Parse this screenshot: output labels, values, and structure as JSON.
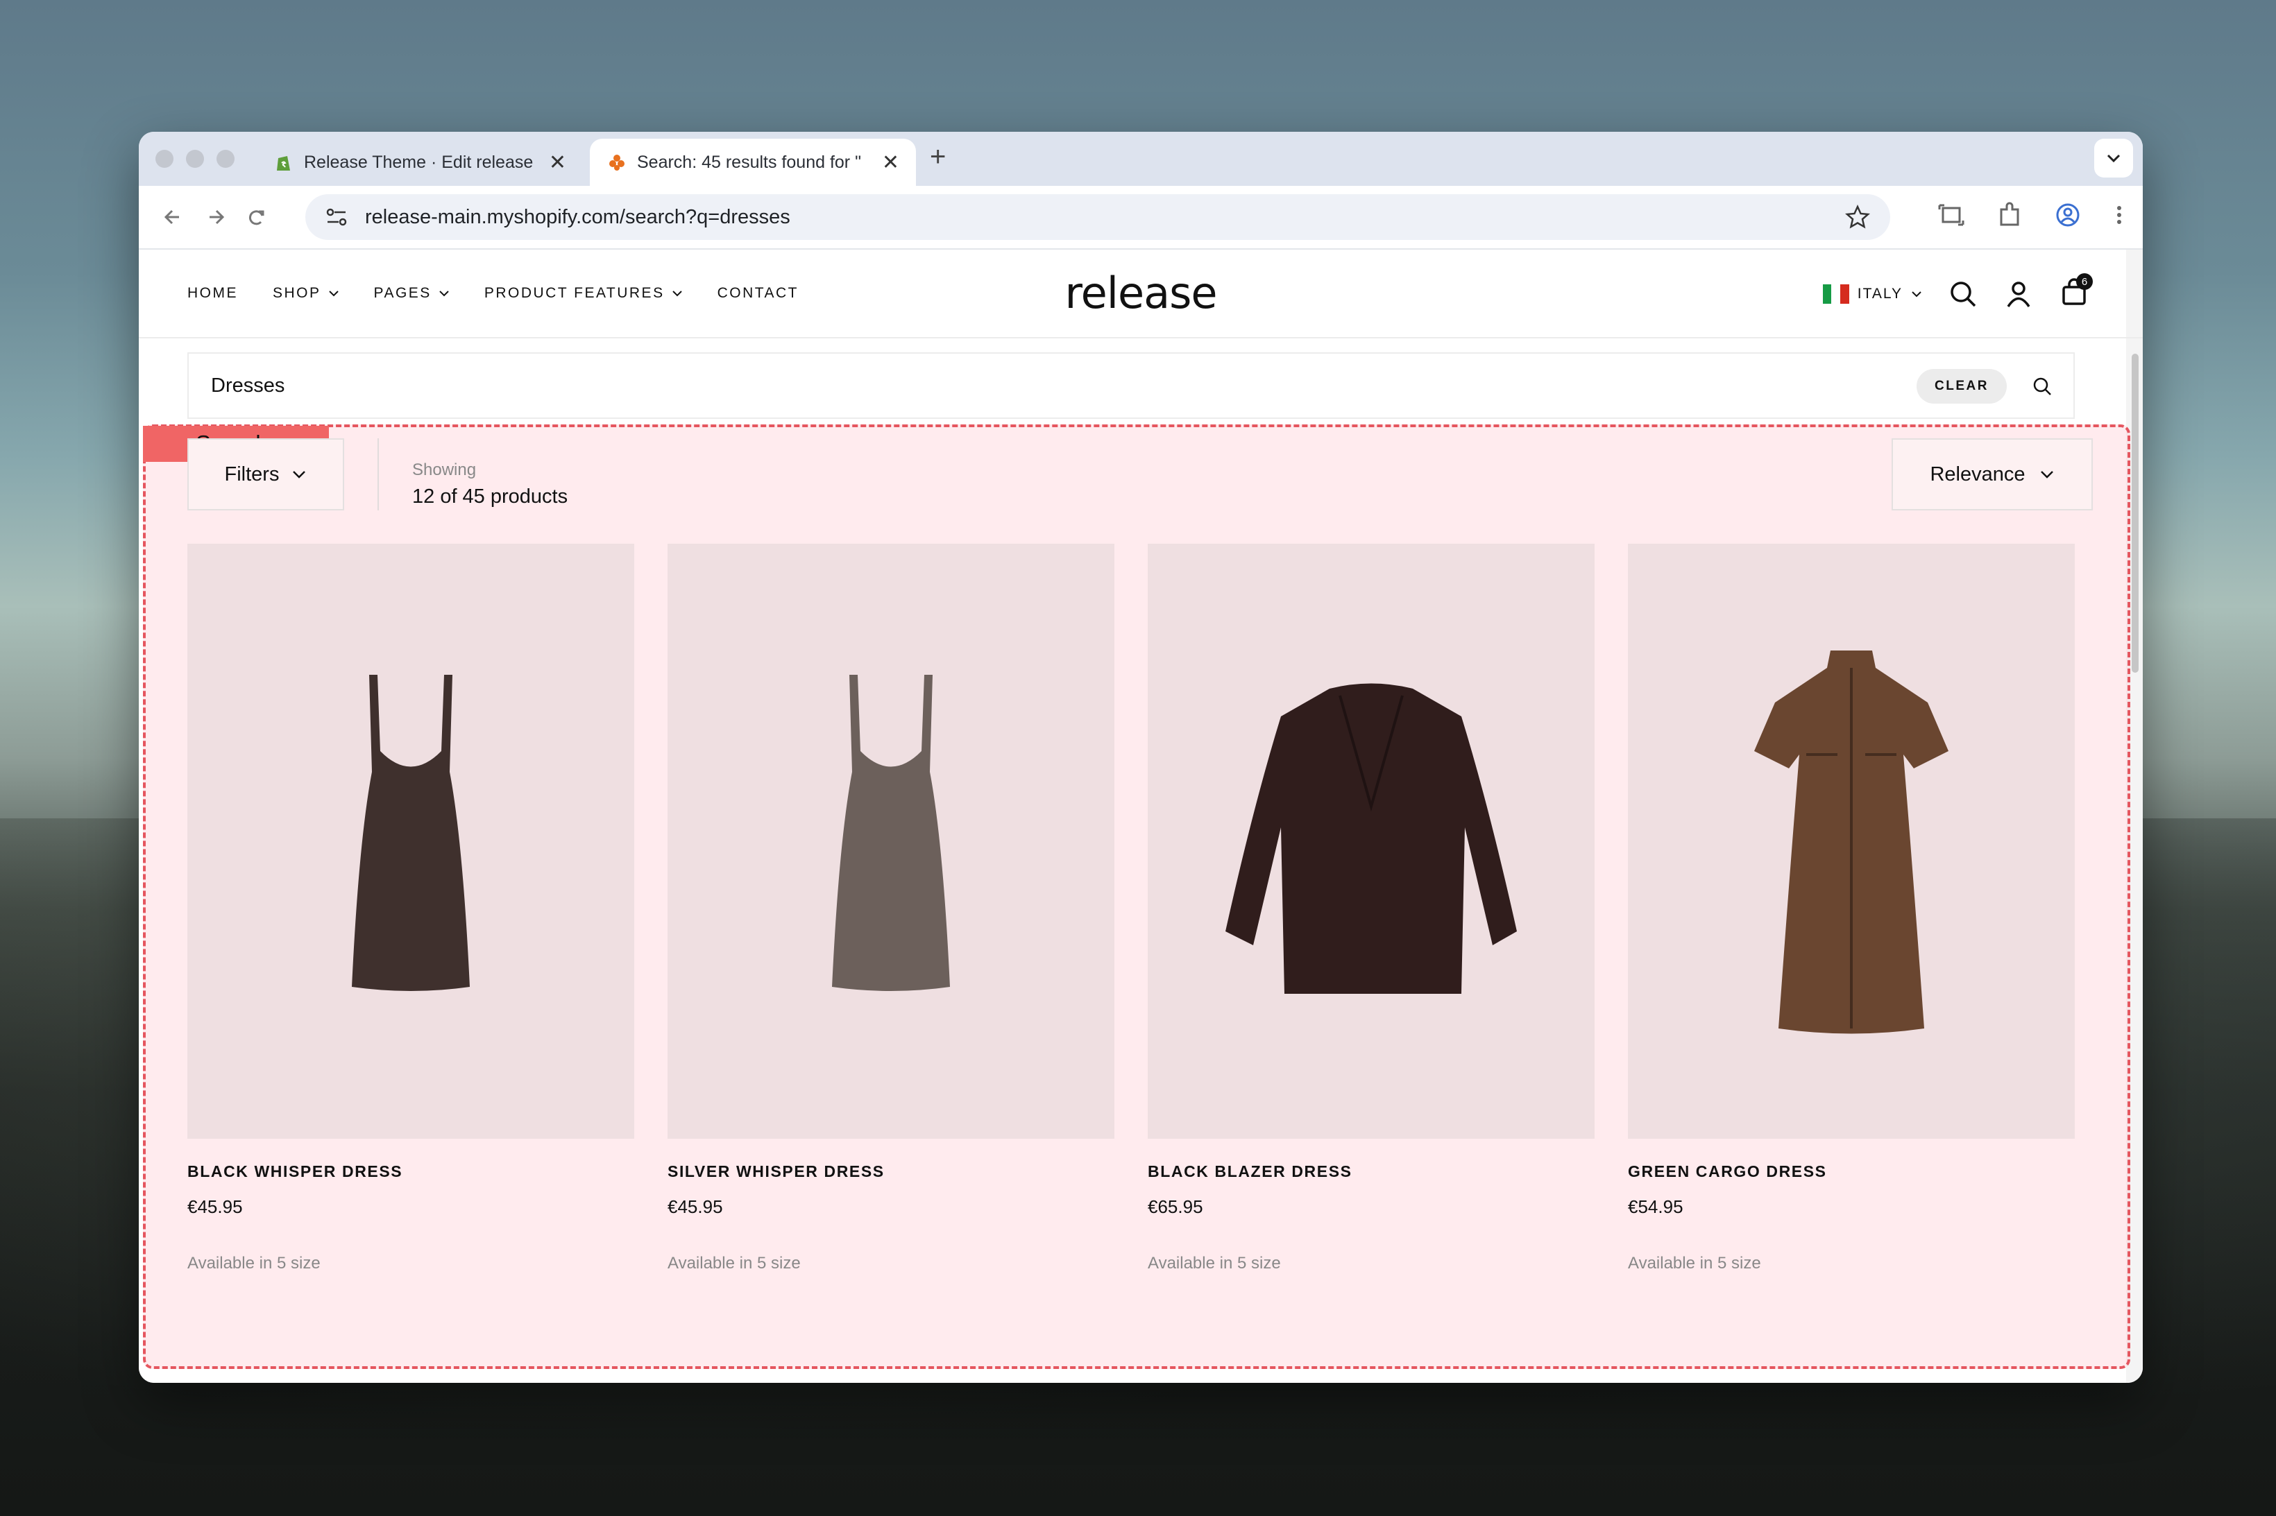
{
  "browser": {
    "tabs": [
      {
        "title": "Release Theme · Edit release",
        "active": false
      },
      {
        "title": "Search: 45 results found for \"",
        "active": true
      }
    ],
    "new_tab": "+",
    "close": "✕",
    "url": "release-main.myshopify.com/search?q=dresses"
  },
  "site": {
    "nav": [
      {
        "label": "HOME",
        "dropdown": false
      },
      {
        "label": "SHOP",
        "dropdown": true
      },
      {
        "label": "PAGES",
        "dropdown": true
      },
      {
        "label": "PRODUCT FEATURES",
        "dropdown": true
      },
      {
        "label": "CONTACT",
        "dropdown": false
      }
    ],
    "logo": "release",
    "country": "ITALY",
    "cart_count": "6"
  },
  "search": {
    "query": "Dresses",
    "clear_label": "CLEAR"
  },
  "annotation": {
    "label": "Search",
    "color": "#f06565"
  },
  "results": {
    "filters_label": "Filters",
    "showing_label": "Showing",
    "showing_value": "12 of 45 products",
    "sort_label": "Relevance",
    "products": [
      {
        "name": "BLACK WHISPER DRESS",
        "price": "€45.95",
        "availability": "Available in 5 size",
        "image": "dress-icon",
        "color": "#3f302d"
      },
      {
        "name": "SILVER WHISPER DRESS",
        "price": "€45.95",
        "availability": "Available in 5 size",
        "image": "dress-icon",
        "color": "#6c605b"
      },
      {
        "name": "BLACK BLAZER DRESS",
        "price": "€65.95",
        "availability": "Available in 5 size",
        "image": "blazer-icon",
        "color": "#301d1c"
      },
      {
        "name": "GREEN CARGO DRESS",
        "price": "€54.95",
        "availability": "Available in 5 size",
        "image": "shirt-dress-icon",
        "color": "#6a4630"
      }
    ]
  }
}
